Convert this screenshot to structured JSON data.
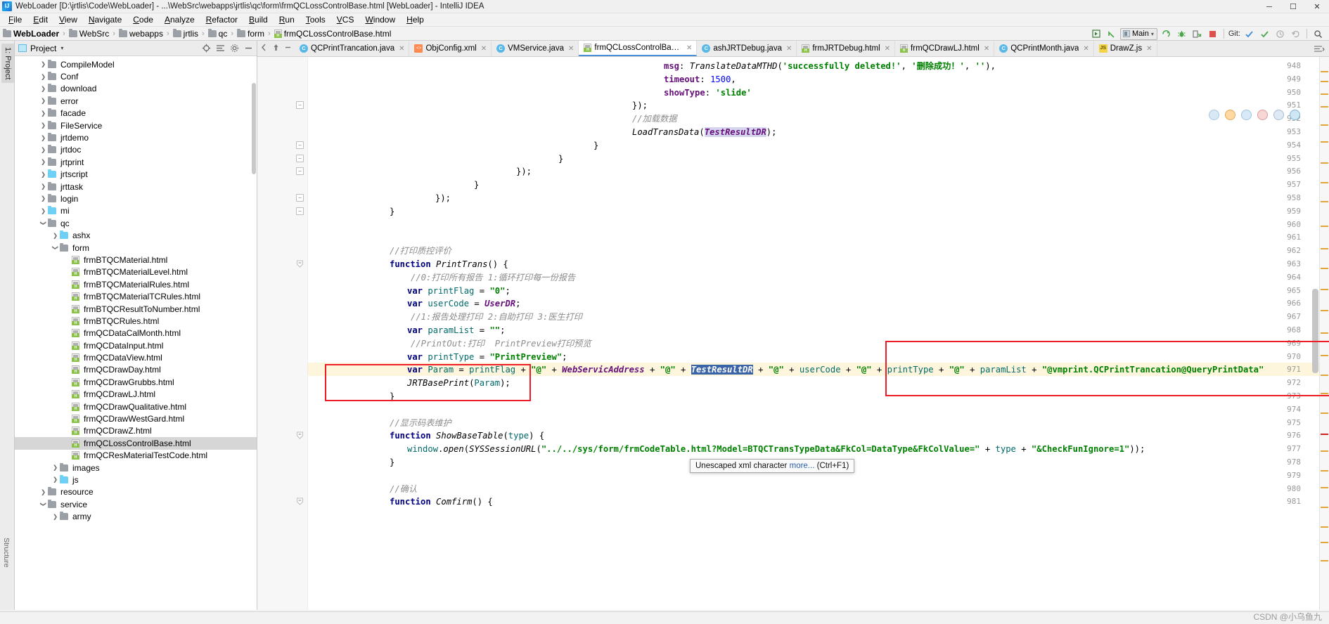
{
  "window": {
    "title": "WebLoader [D:\\jrtlis\\Code\\WebLoader] - ...\\WebSrc\\webapps\\jrtlis\\qc\\form\\frmQCLossControlBase.html [WebLoader] - IntelliJ IDEA",
    "logo": "IJ",
    "minimize": "─",
    "maximize": "☐",
    "close": "✕"
  },
  "menubar": [
    "File",
    "Edit",
    "View",
    "Navigate",
    "Code",
    "Analyze",
    "Refactor",
    "Build",
    "Run",
    "Tools",
    "VCS",
    "Window",
    "Help"
  ],
  "breadcrumb": [
    {
      "label": "WebLoader",
      "icon": "folder-icon",
      "bold": true,
      "color": "grey"
    },
    {
      "label": "WebSrc",
      "icon": "folder-icon",
      "bold": false,
      "color": "grey"
    },
    {
      "label": "webapps",
      "icon": "folder-icon",
      "bold": false,
      "color": "grey"
    },
    {
      "label": "jrtlis",
      "icon": "folder-icon",
      "bold": false,
      "color": "grey"
    },
    {
      "label": "qc",
      "icon": "folder-icon",
      "bold": false,
      "color": "grey"
    },
    {
      "label": "form",
      "icon": "folder-icon",
      "bold": false,
      "color": "grey"
    },
    {
      "label": "frmQCLossControlBase.html",
      "icon": "html-file-icon",
      "bold": false,
      "color": "html"
    }
  ],
  "toolbar": {
    "run_config_name": "Main",
    "git_label": "Git:",
    "icons": [
      "build-icon",
      "back-arrow-icon",
      "run-icon",
      "debug-icon",
      "coverage-icon",
      "stop-icon",
      "commit-check-icon",
      "update-check-icon",
      "history-icon",
      "rollback-icon",
      "search-icon"
    ]
  },
  "project_panel": {
    "title": "Project",
    "header_icons": [
      "locate-icon",
      "collapse-icon",
      "settings-icon",
      "hide-icon"
    ],
    "vertical_tab": "1: Project",
    "tree": [
      {
        "label": "CompileModel",
        "depth": 2,
        "arrow": "right",
        "icon": "folder-icon",
        "color": "grey"
      },
      {
        "label": "Conf",
        "depth": 2,
        "arrow": "right",
        "icon": "folder-icon",
        "color": "grey"
      },
      {
        "label": "download",
        "depth": 2,
        "arrow": "right",
        "icon": "folder-icon",
        "color": "grey"
      },
      {
        "label": "error",
        "depth": 2,
        "arrow": "right",
        "icon": "folder-icon",
        "color": "grey"
      },
      {
        "label": "facade",
        "depth": 2,
        "arrow": "right",
        "icon": "folder-icon",
        "color": "grey"
      },
      {
        "label": "FileService",
        "depth": 2,
        "arrow": "right",
        "icon": "folder-icon",
        "color": "grey"
      },
      {
        "label": "jrtdemo",
        "depth": 2,
        "arrow": "right",
        "icon": "folder-icon",
        "color": "grey"
      },
      {
        "label": "jrtdoc",
        "depth": 2,
        "arrow": "right",
        "icon": "folder-icon",
        "color": "grey"
      },
      {
        "label": "jrtprint",
        "depth": 2,
        "arrow": "right",
        "icon": "folder-icon",
        "color": "grey"
      },
      {
        "label": "jrtscript",
        "depth": 2,
        "arrow": "right",
        "icon": "folder-icon",
        "color": "blue"
      },
      {
        "label": "jrttask",
        "depth": 2,
        "arrow": "right",
        "icon": "folder-icon",
        "color": "grey"
      },
      {
        "label": "login",
        "depth": 2,
        "arrow": "right",
        "icon": "folder-icon",
        "color": "grey"
      },
      {
        "label": "mi",
        "depth": 2,
        "arrow": "right",
        "icon": "folder-icon",
        "color": "blue"
      },
      {
        "label": "qc",
        "depth": 2,
        "arrow": "down",
        "icon": "folder-icon",
        "color": "grey"
      },
      {
        "label": "ashx",
        "depth": 3,
        "arrow": "right",
        "icon": "folder-icon",
        "color": "blue"
      },
      {
        "label": "form",
        "depth": 3,
        "arrow": "down",
        "icon": "folder-icon",
        "color": "grey"
      },
      {
        "label": "frmBTQCMaterial.html",
        "depth": 4,
        "arrow": "none",
        "icon": "html-file-icon",
        "color": "html"
      },
      {
        "label": "frmBTQCMaterialLevel.html",
        "depth": 4,
        "arrow": "none",
        "icon": "html-file-icon",
        "color": "html"
      },
      {
        "label": "frmBTQCMaterialRules.html",
        "depth": 4,
        "arrow": "none",
        "icon": "html-file-icon",
        "color": "html"
      },
      {
        "label": "frmBTQCMaterialTCRules.html",
        "depth": 4,
        "arrow": "none",
        "icon": "html-file-icon",
        "color": "html"
      },
      {
        "label": "frmBTQCResultToNumber.html",
        "depth": 4,
        "arrow": "none",
        "icon": "html-file-icon",
        "color": "html"
      },
      {
        "label": "frmBTQCRules.html",
        "depth": 4,
        "arrow": "none",
        "icon": "html-file-icon",
        "color": "html"
      },
      {
        "label": "frmQCDataCalMonth.html",
        "depth": 4,
        "arrow": "none",
        "icon": "html-file-icon",
        "color": "html"
      },
      {
        "label": "frmQCDataInput.html",
        "depth": 4,
        "arrow": "none",
        "icon": "html-file-icon",
        "color": "html"
      },
      {
        "label": "frmQCDataView.html",
        "depth": 4,
        "arrow": "none",
        "icon": "html-file-icon",
        "color": "html"
      },
      {
        "label": "frmQCDrawDay.html",
        "depth": 4,
        "arrow": "none",
        "icon": "html-file-icon",
        "color": "html"
      },
      {
        "label": "frmQCDrawGrubbs.html",
        "depth": 4,
        "arrow": "none",
        "icon": "html-file-icon",
        "color": "html"
      },
      {
        "label": "frmQCDrawLJ.html",
        "depth": 4,
        "arrow": "none",
        "icon": "html-file-icon",
        "color": "html"
      },
      {
        "label": "frmQCDrawQualitative.html",
        "depth": 4,
        "arrow": "none",
        "icon": "html-file-icon",
        "color": "html"
      },
      {
        "label": "frmQCDrawWestGard.html",
        "depth": 4,
        "arrow": "none",
        "icon": "html-file-icon",
        "color": "html"
      },
      {
        "label": "frmQCDrawZ.html",
        "depth": 4,
        "arrow": "none",
        "icon": "html-file-icon",
        "color": "html"
      },
      {
        "label": "frmQCLossControlBase.html",
        "depth": 4,
        "arrow": "none",
        "icon": "html-file-icon",
        "color": "html",
        "selected": true
      },
      {
        "label": "frmQCResMaterialTestCode.html",
        "depth": 4,
        "arrow": "none",
        "icon": "html-file-icon",
        "color": "html"
      },
      {
        "label": "images",
        "depth": 3,
        "arrow": "right",
        "icon": "folder-icon",
        "color": "grey"
      },
      {
        "label": "js",
        "depth": 3,
        "arrow": "right",
        "icon": "folder-icon",
        "color": "blue"
      },
      {
        "label": "resource",
        "depth": 2,
        "arrow": "right",
        "icon": "folder-icon",
        "color": "grey"
      },
      {
        "label": "service",
        "depth": 2,
        "arrow": "down",
        "icon": "folder-icon",
        "color": "grey"
      },
      {
        "label": "army",
        "depth": 3,
        "arrow": "right",
        "icon": "folder-icon",
        "color": "grey"
      }
    ]
  },
  "editor_tabs": [
    {
      "label": "QCPrintTrancation.java",
      "icon": "java-file-icon",
      "active": false
    },
    {
      "label": "ObjConfig.xml",
      "icon": "xml-file-icon",
      "active": false
    },
    {
      "label": "VMService.java",
      "icon": "java-file-icon",
      "active": false
    },
    {
      "label": "frmQCLossControlBase.html",
      "icon": "html-file-icon",
      "active": true
    },
    {
      "label": "ashJRTDebug.java",
      "icon": "java-file-icon",
      "active": false
    },
    {
      "label": "frmJRTDebug.html",
      "icon": "html-file-icon",
      "active": false
    },
    {
      "label": "frmQCDrawLJ.html",
      "icon": "html-file-icon",
      "active": false
    },
    {
      "label": "QCPrintMonth.java",
      "icon": "java-file-icon",
      "active": false
    },
    {
      "label": "DrawZ.js",
      "icon": "js-file-icon",
      "active": false
    }
  ],
  "code": {
    "first_line": 948,
    "highlight_line": 971,
    "lines": [
      {
        "n": 948,
        "indent": 0,
        "fold": "",
        "html": "<span class='p'>msg</span><span class='t'>: </span><span class='f'>TranslateDataMTHD</span><span class='t'>(</span><span class='s'>'successfully deleted!'</span><span class='t'>, </span><span class='s'>'删除成功！'</span><span class='t'>, </span><span class='s'>''</span><span class='t'>),</span>",
        "pad": 500
      },
      {
        "n": 949,
        "indent": 0,
        "fold": "",
        "html": "<span class='p'>timeout</span><span class='t'>: </span><span class='n'>1500</span><span class='t'>,</span>",
        "pad": 500
      },
      {
        "n": 950,
        "indent": 0,
        "fold": "",
        "html": "<span class='p'>showType</span><span class='t'>: </span><span class='s'>'slide'</span>",
        "pad": 500
      },
      {
        "n": 951,
        "indent": 0,
        "fold": "minus",
        "html": "<span class='t'>});</span>",
        "pad": 455
      },
      {
        "n": 952,
        "indent": 0,
        "fold": "",
        "html": "<span class='c'>//加载数据</span>",
        "pad": 455
      },
      {
        "n": 953,
        "indent": 0,
        "fold": "",
        "html": "<span class='f'>LoadTransData</span><span class='t'>(</span><span class='occ-tok'>TestResultDR</span><span class='t'>);</span>",
        "pad": 455
      },
      {
        "n": 954,
        "indent": 0,
        "fold": "minus",
        "html": "<span class='t'>}</span>",
        "pad": 400
      },
      {
        "n": 955,
        "indent": 0,
        "fold": "minus",
        "html": "<span class='t'>}</span>",
        "pad": 350
      },
      {
        "n": 956,
        "indent": 0,
        "fold": "minus",
        "html": "<span class='t'>});</span>",
        "pad": 290
      },
      {
        "n": 957,
        "indent": 0,
        "fold": "",
        "html": "<span class='t'>}</span>",
        "pad": 230
      },
      {
        "n": 958,
        "indent": 0,
        "fold": "minus",
        "html": "<span class='t'>});</span>",
        "pad": 175
      },
      {
        "n": 959,
        "indent": 0,
        "fold": "minus",
        "html": "<span class='t'>}</span>",
        "pad": 110
      },
      {
        "n": 960,
        "indent": 0,
        "fold": "",
        "html": "",
        "pad": 0
      },
      {
        "n": 961,
        "indent": 0,
        "fold": "",
        "html": "",
        "pad": 0
      },
      {
        "n": 962,
        "indent": 0,
        "fold": "",
        "html": "<span class='c'>//打印质控评价</span>",
        "pad": 110
      },
      {
        "n": 963,
        "indent": 0,
        "fold": "tri",
        "html": "<span class='k'>function</span> <span class='f'>PrintTrans</span><span class='t'>() {</span>",
        "pad": 110
      },
      {
        "n": 964,
        "indent": 0,
        "fold": "",
        "html": "<span class='c'>//0:打印所有报告 1:循环打印每一份报告</span>",
        "pad": 140
      },
      {
        "n": 965,
        "indent": 0,
        "fold": "",
        "html": "<span class='k'>var</span> <span class='v'>printFlag</span> <span class='t'>= </span><span class='s'>\"0\"</span><span class='t'>;</span>",
        "pad": 135
      },
      {
        "n": 966,
        "indent": 0,
        "fold": "",
        "html": "<span class='k'>var</span> <span class='v'>userCode</span> <span class='t'>= </span><span class='g'>UserDR</span><span class='t'>;</span>",
        "pad": 135
      },
      {
        "n": 967,
        "indent": 0,
        "fold": "",
        "html": "<span class='c'>//1:报告处理打印 2:自助打印 3:医生打印</span>",
        "pad": 140
      },
      {
        "n": 968,
        "indent": 0,
        "fold": "",
        "html": "<span class='k'>var</span> <span class='v'>paramList</span> <span class='t'>= </span><span class='s'>\"\"</span><span class='t'>;</span>",
        "pad": 135
      },
      {
        "n": 969,
        "indent": 0,
        "fold": "",
        "html": "<span class='c'>//PrintOut:打印  PrintPreview打印预览</span>",
        "pad": 140
      },
      {
        "n": 970,
        "indent": 0,
        "fold": "",
        "html": "<span class='k'>var</span> <span class='v'>printType</span> <span class='t'>= </span><span class='s'>\"PrintPreview\"</span><span class='t'>;</span>",
        "pad": 135
      },
      {
        "n": 971,
        "indent": 0,
        "fold": "",
        "html": "<span class='k'>var</span> <span class='v'>Param</span> <span class='t'>= </span><span class='v'>printFlag</span> <span class='t'>+ </span><span class='s'>\"@\"</span> <span class='t'>+ </span><span class='g'>WebServicAddress</span> <span class='t'>+ </span><span class='s'>\"@\"</span> <span class='t'>+ </span><span class='sel-tok'>TestResultDR</span> <span class='t'>+ </span><span class='s'>\"@\"</span> <span class='t'>+ </span><span class='v'>userCode</span> <span class='t'>+ </span><span class='s'>\"@\"</span> <span class='t'>+ </span><span class='v'>printType</span> <span class='t'>+ </span><span class='s'>\"@\"</span> <span class='t'>+ </span><span class='v'>paramList</span> <span class='t'>+ </span><span class='s'>\"@vmprint.QCPrintTrancation@QueryPrintData\"</span>",
        "pad": 135
      },
      {
        "n": 972,
        "indent": 0,
        "fold": "",
        "html": "<span class='f'>JRTBasePrint</span><span class='t'>(</span><span class='v'>Param</span><span class='t'>);</span>",
        "pad": 135
      },
      {
        "n": 973,
        "indent": 0,
        "fold": "",
        "html": "<span class='t'>}</span>",
        "pad": 110
      },
      {
        "n": 974,
        "indent": 0,
        "fold": "",
        "html": "",
        "pad": 0
      },
      {
        "n": 975,
        "indent": 0,
        "fold": "",
        "html": "<span class='c'>//显示码表维护</span>",
        "pad": 110
      },
      {
        "n": 976,
        "indent": 0,
        "fold": "tri",
        "html": "<span class='k'>function</span> <span class='f'>ShowBaseTable</span><span class='t'>(</span><span class='err-underline v'>type</span><span class='t'>) {</span>",
        "pad": 110
      },
      {
        "n": 977,
        "indent": 0,
        "fold": "",
        "html": "<span class='v'>window</span><span class='t'>.</span><span class='f'>open</span><span class='t'>(</span><span class='f'>SYSSessionURL</span><span class='t'>(</span><span class='s err-underline'>\"../../sys/form/frmCodeTable.html?Model=BTQCTransTypeData&FkCol=DataType&FkColValue=\"</span> <span class='t'>+ </span><span class='err-underline v'>type</span> <span class='t'>+ </span><span class='s err-underline'>\"&CheckFunIgnore=1\"</span><span class='t'>));</span>",
        "pad": 135
      },
      {
        "n": 978,
        "indent": 0,
        "fold": "",
        "html": "<span class='t'>}</span>",
        "pad": 110
      },
      {
        "n": 979,
        "indent": 0,
        "fold": "",
        "html": "",
        "pad": 0
      },
      {
        "n": 980,
        "indent": 0,
        "fold": "",
        "html": "<span class='c'>//确认</span>",
        "pad": 110
      },
      {
        "n": 981,
        "indent": 0,
        "fold": "tri",
        "html": "<span class='k'>function</span> <span class='f'>Comfirm</span><span class='t'>() {</span>",
        "pad": 110
      }
    ]
  },
  "tooltip": {
    "text": "Unescaped xml character",
    "link": "more...",
    "shortcut": "(Ctrl+F1)"
  },
  "annotations": {
    "box_color": "#ee1c25",
    "boxes": [
      {
        "name": "jrt-base-print-callout"
      },
      {
        "name": "vmprint-param-callout"
      }
    ]
  },
  "watermark": "CSDN @小乌鱼九",
  "statusbar": {
    "text": ""
  }
}
